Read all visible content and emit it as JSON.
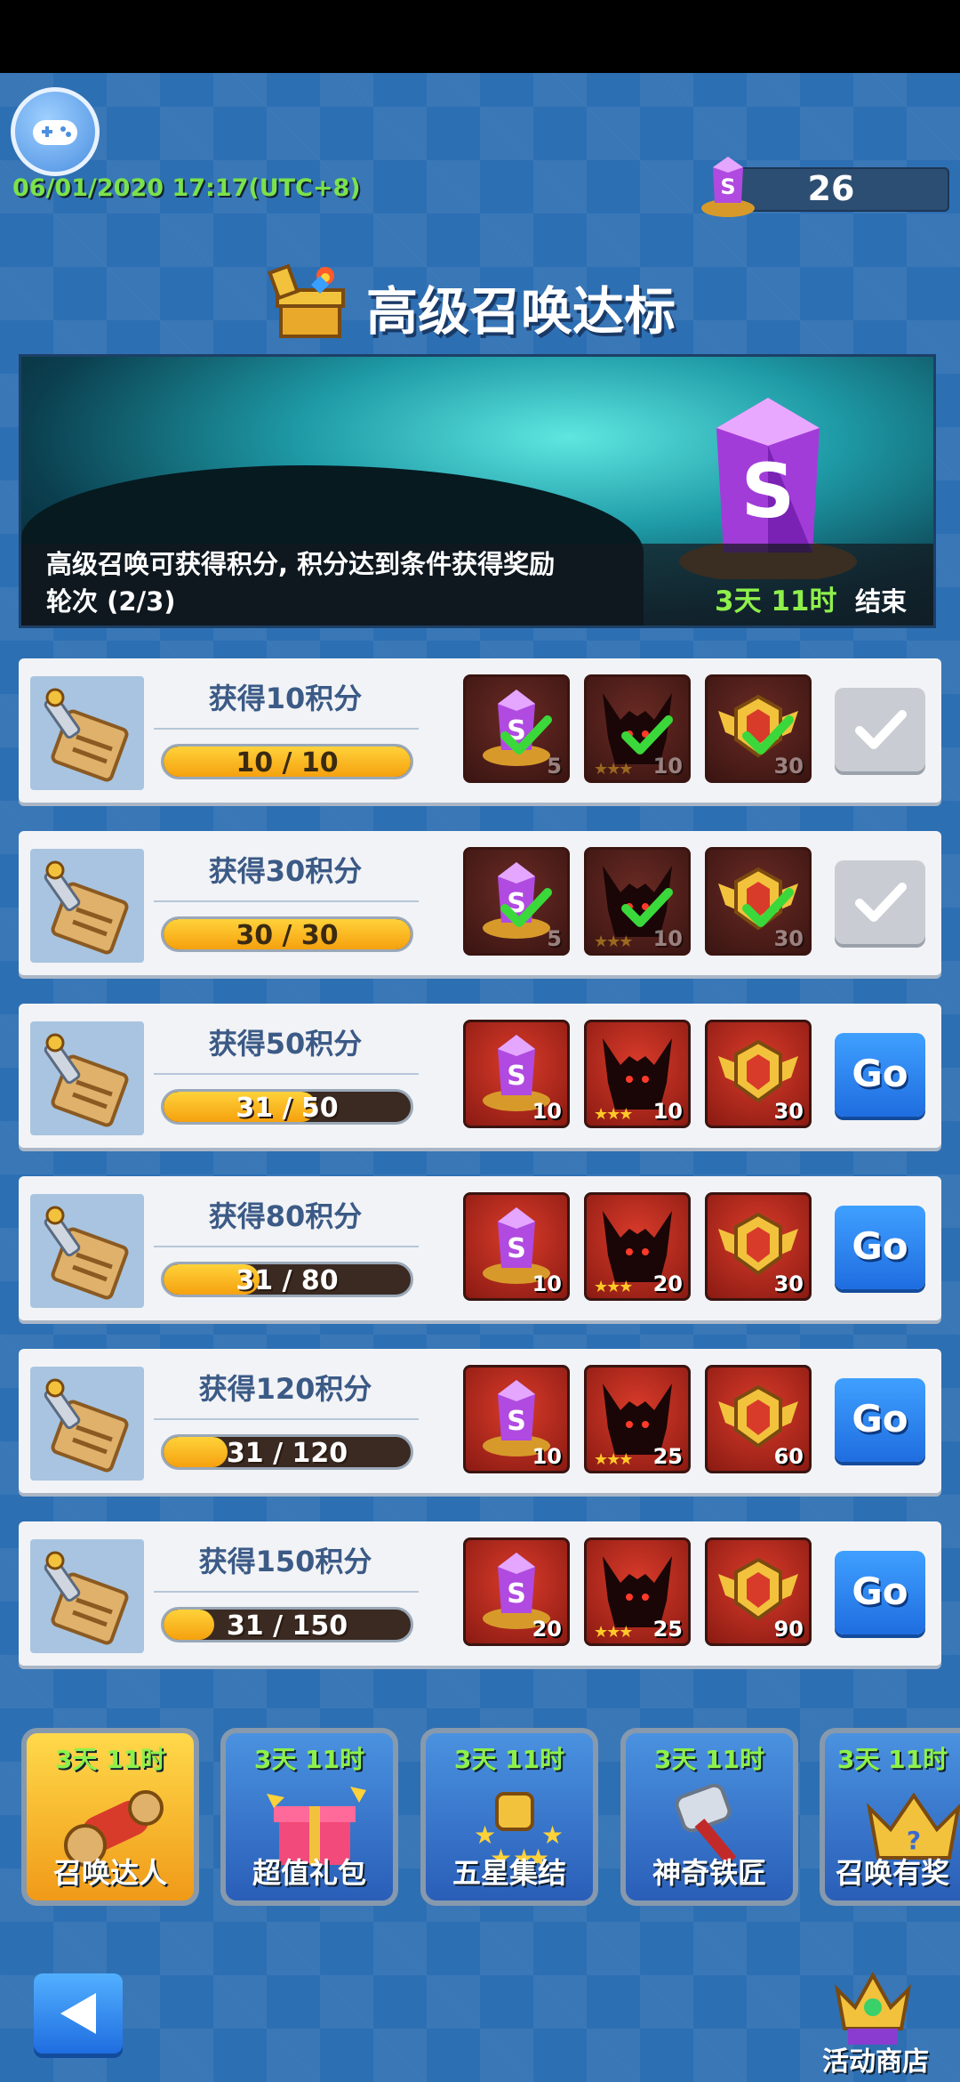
{
  "header": {
    "datetime": "06/01/2020 17:17(UTC+8)",
    "gem_count": "26",
    "title": "高级召唤达标"
  },
  "banner": {
    "description": "高级召唤可获得积分, 积分达到条件获得奖励",
    "round": "轮次 (2/3)",
    "time_left": "3天 11时",
    "end_label": "结束"
  },
  "tasks": [
    {
      "goal": "获得10积分",
      "progress_text": "10 / 10",
      "progress": 1.0,
      "status": "claimed",
      "rewards": [
        {
          "icon": "gem-icon",
          "qty": "5"
        },
        {
          "icon": "hero-silhouette-icon",
          "qty": "10",
          "stars": "★★★"
        },
        {
          "icon": "badge-icon",
          "qty": "30"
        }
      ]
    },
    {
      "goal": "获得30积分",
      "progress_text": "30 / 30",
      "progress": 1.0,
      "status": "claimed",
      "rewards": [
        {
          "icon": "gem-icon",
          "qty": "5"
        },
        {
          "icon": "hero-silhouette-icon",
          "qty": "10",
          "stars": "★★★"
        },
        {
          "icon": "badge-icon",
          "qty": "30"
        }
      ]
    },
    {
      "goal": "获得50积分",
      "progress_text": "31 / 50",
      "progress": 0.62,
      "status": "go",
      "button": "Go",
      "rewards": [
        {
          "icon": "gem-icon",
          "qty": "10"
        },
        {
          "icon": "hero-silhouette-icon",
          "qty": "10",
          "stars": "★★★"
        },
        {
          "icon": "badge-icon",
          "qty": "30"
        }
      ]
    },
    {
      "goal": "获得80积分",
      "progress_text": "31 / 80",
      "progress": 0.3875,
      "status": "go",
      "button": "Go",
      "rewards": [
        {
          "icon": "gem-icon",
          "qty": "10"
        },
        {
          "icon": "hero-silhouette-icon",
          "qty": "20",
          "stars": "★★★"
        },
        {
          "icon": "badge-icon",
          "qty": "30"
        }
      ]
    },
    {
      "goal": "获得120积分",
      "progress_text": "31 / 120",
      "progress": 0.2583,
      "status": "go",
      "button": "Go",
      "rewards": [
        {
          "icon": "gem-icon",
          "qty": "10"
        },
        {
          "icon": "hero-silhouette-icon",
          "qty": "25",
          "stars": "★★★"
        },
        {
          "icon": "badge-icon",
          "qty": "60"
        }
      ]
    },
    {
      "goal": "获得150积分",
      "progress_text": "31 / 150",
      "progress": 0.2067,
      "status": "go",
      "button": "Go",
      "rewards": [
        {
          "icon": "gem-icon",
          "qty": "20"
        },
        {
          "icon": "hero-silhouette-icon",
          "qty": "25",
          "stars": "★★★"
        },
        {
          "icon": "badge-icon",
          "qty": "90"
        }
      ]
    }
  ],
  "events": [
    {
      "time": "3天 11时",
      "name": "召唤达人",
      "icon": "scroll-icon"
    },
    {
      "time": "3天 11时",
      "name": "超值礼包",
      "icon": "gift-box-icon"
    },
    {
      "time": "3天 11时",
      "name": "五星集结",
      "icon": "five-star-icon"
    },
    {
      "time": "3天 11时",
      "name": "神奇铁匠",
      "icon": "hammer-icon"
    },
    {
      "time": "3天 11时",
      "name": "召唤有奖",
      "icon": "crown-icon"
    }
  ],
  "footer": {
    "shop_label": "活动商店"
  },
  "colors": {
    "accent_green": "#8ef04a",
    "go_button": "#1f6de0",
    "progress_fill": "#f5a10e"
  }
}
